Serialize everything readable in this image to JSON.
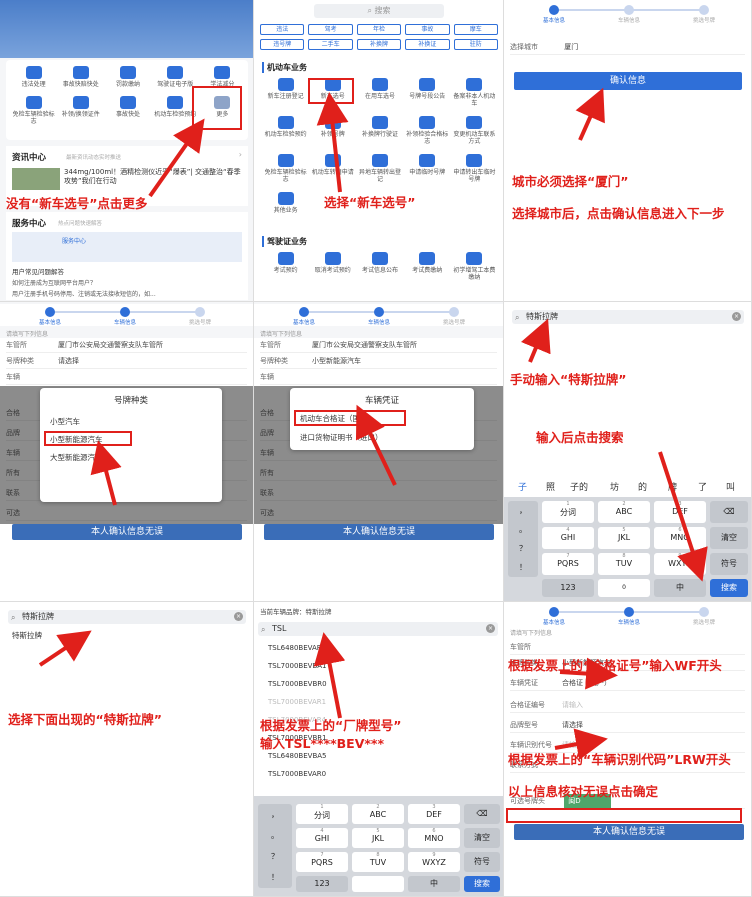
{
  "p1": {
    "grid": [
      "违法处理",
      "事故快赔快处",
      "罚款缴纳",
      "驾驶证电子版",
      "学法减分",
      "免检车辆检验标志",
      "补领/换领证件",
      "事故快处",
      "机动车检验预约",
      "更多"
    ],
    "news_title": "资讯中心",
    "news_sub": "最新资讯动态实时推送",
    "news_headline": "344mg/100ml！酒精检测仪近乎“爆表”| 交通整治“春季攻势”我们在行动",
    "service_title": "服务中心",
    "service_sub": "热点问题快速解答",
    "service_banner": "服务中心",
    "faq_title": "用户常见问题解答",
    "faq1": "如何注册成为互联网平台用户？",
    "faq2": "用户注册手机号码停用、注销或无法接收短信的，如...",
    "ann": "没有“新车选号”点击更多"
  },
  "p2": {
    "search": "搜索",
    "tags": [
      "违法",
      "驾考",
      "年检",
      "事故",
      "摩车",
      "违号牌",
      "二手车",
      "补换牌",
      "补换证",
      "驻防"
    ],
    "section1": "机动车业务",
    "grid1": [
      "新车注册登记",
      "新车选号",
      "在用车选号",
      "号牌号段公告",
      "备案非本人机动车",
      "机动车检验预约",
      "补领号牌",
      "补换牌行驶证",
      "补领检验合格标志",
      "变更机动车联系方式",
      "免检车辆检验标志",
      "机动车转籍申请",
      "异地车辆转出登记",
      "申请临时号牌",
      "申请转出车临时号牌",
      "其他业务"
    ],
    "section2": "驾驶证业务",
    "grid2": [
      "考试预约",
      "取消考试预约",
      "考试信息公布",
      "考试费缴纳",
      "初学增驾工本费缴纳"
    ],
    "ann": "选择“新车选号”"
  },
  "p3": {
    "steps": [
      "基本信息",
      "车辆信息",
      "挑选号牌"
    ],
    "city_label": "选择城市",
    "city_value": "厦门",
    "confirm": "确认信息",
    "ann1": "城市必须选择“厦门”",
    "ann2": "选择城市后，点击确认信息进入下一步"
  },
  "p4": {
    "steps": [
      "基本信息",
      "车辆信息",
      "挑选号牌"
    ],
    "hint": "请填写下列信息",
    "rows": [
      {
        "label": "车管所",
        "value": "厦门市公安局交通警察支队车管所"
      },
      {
        "label": "号牌种类",
        "value": "请选择"
      },
      {
        "label": "车辆",
        "value": ""
      },
      {
        "label": "合格",
        "value": ""
      },
      {
        "label": "品牌",
        "value": ""
      },
      {
        "label": "车辆",
        "value": ""
      },
      {
        "label": "所有",
        "value": ""
      },
      {
        "label": "联系",
        "value": ""
      },
      {
        "label": "可选",
        "value": ""
      }
    ],
    "modal_title": "号牌种类",
    "options": [
      "小型汽车",
      "小型新能源汽车",
      "大型新能源汽车"
    ],
    "bottom": "本人确认信息无误"
  },
  "p5": {
    "steps": [
      "基本信息",
      "车辆信息",
      "挑选号牌"
    ],
    "hint": "请填写下列信息",
    "rows": [
      {
        "label": "车管所",
        "value": "厦门市公安局交通警察支队车管所"
      },
      {
        "label": "号牌种类",
        "value": "小型新能源汽车"
      },
      {
        "label": "车辆",
        "value": ""
      },
      {
        "label": "合格",
        "value": ""
      },
      {
        "label": "品牌",
        "value": ""
      },
      {
        "label": "车辆",
        "value": ""
      },
      {
        "label": "所有",
        "value": ""
      },
      {
        "label": "联系",
        "value": ""
      },
      {
        "label": "可选",
        "value": ""
      }
    ],
    "modal_title": "车辆凭证",
    "options": [
      "机动车合格证（国产）",
      "进口货物证明书（进口）"
    ],
    "bottom": "本人确认信息无误"
  },
  "p6": {
    "search": "特斯拉牌",
    "ann1": "手动输入“特斯拉牌”",
    "ann2": "输入后点击搜索",
    "candidates": [
      "子",
      "照",
      "子的",
      "坊",
      "的",
      "牌",
      "了",
      "叫"
    ],
    "keys": [
      {
        "main": "分词",
        "sub": "1"
      },
      {
        "main": "ABC",
        "sub": "2"
      },
      {
        "main": "DEF",
        "sub": "3"
      },
      {
        "main": "GHI",
        "sub": "4"
      },
      {
        "main": "JKL",
        "sub": "5"
      },
      {
        "main": "MNO",
        "sub": "6"
      },
      {
        "main": "PQRS",
        "sub": "7"
      },
      {
        "main": "TUV",
        "sub": "8"
      },
      {
        "main": "WXYZ",
        "sub": "9"
      }
    ],
    "side": [
      "，",
      "。",
      "？",
      "！"
    ],
    "del": "⌫",
    "clear": "清空",
    "sym": "符号",
    "num": "123",
    "space": "0",
    "lang": "中",
    "search_btn": "搜索"
  },
  "p7": {
    "search": "特斯拉牌",
    "result": "特斯拉牌",
    "ann": "选择下面出现的“特斯拉牌”"
  },
  "p8": {
    "brand_label": "当前车辆品牌：特斯拉牌",
    "search": "TSL",
    "models": [
      "TSL6480BEVAR",
      "TSL7000BEVBA1",
      "TSL7000BEVBR0",
      "TSL7000BEVAR1",
      "TSL7000BEVAR4",
      "TSL7000BEVBR1",
      "TSL6480BEVBA5",
      "TSL7000BEVAR0"
    ],
    "ann1": "根据发票上的“厂牌型号”",
    "ann2": "输入TSL****BEV***",
    "keys": [
      {
        "main": "分词",
        "sub": "1"
      },
      {
        "main": "ABC",
        "sub": "2"
      },
      {
        "main": "DEF",
        "sub": "3"
      },
      {
        "main": "GHI",
        "sub": "4"
      },
      {
        "main": "JKL",
        "sub": "5"
      },
      {
        "main": "MNO",
        "sub": "6"
      },
      {
        "main": "PQRS",
        "sub": "7"
      },
      {
        "main": "TUV",
        "sub": "8"
      },
      {
        "main": "WXYZ",
        "sub": "9"
      }
    ],
    "side": [
      "，",
      "。",
      "？",
      "！"
    ],
    "clear": "清空",
    "sym": "符号",
    "num": "123",
    "lang": "中",
    "search_btn": "搜索"
  },
  "p9": {
    "steps": [
      "基本信息",
      "车辆信息",
      "挑选号牌"
    ],
    "hint": "请填写下列信息",
    "rows": [
      {
        "label": "车管所",
        "value": ""
      },
      {
        "label": "号牌种类",
        "value": "小型新能源汽车"
      },
      {
        "label": "车辆凭证",
        "value": "合格证（国产）"
      },
      {
        "label": "合格证编号",
        "value": "请输入"
      },
      {
        "label": "品牌型号",
        "value": "请选择"
      },
      {
        "label": "车辆识别代号",
        "value": "请输入"
      },
      {
        "label": "联系方式",
        "value": ""
      }
    ],
    "plate_label": "可选号牌头",
    "plate_value": "闽D",
    "ann1": "根据发票上的“合格证号”输入WF开头",
    "ann2": "根据发票上的“车辆识别代码”LRW开头",
    "ann3": "以上信息核对无误点击确定",
    "bottom": "本人确认信息无误"
  }
}
